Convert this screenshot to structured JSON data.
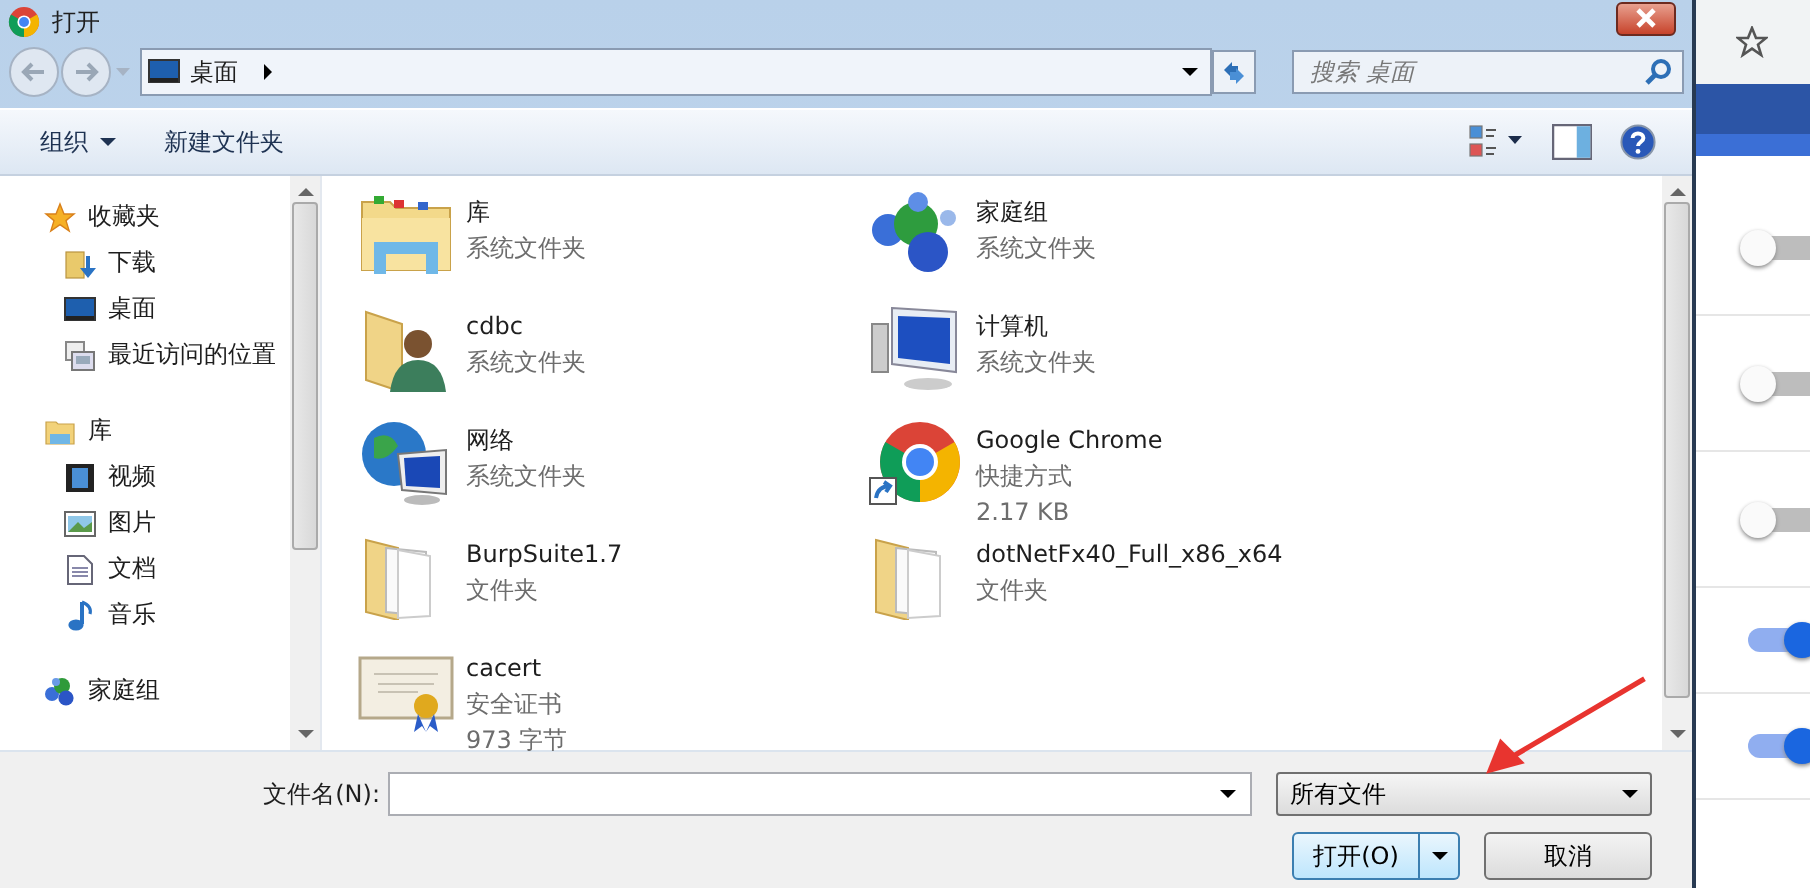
{
  "window": {
    "title": "打开"
  },
  "address": {
    "location": "桌面",
    "search_placeholder": "搜索 桌面"
  },
  "toolbar": {
    "organize": "组织",
    "new_folder": "新建文件夹"
  },
  "sidebar": {
    "groups": [
      {
        "label": "收藏夹",
        "kind": "star",
        "children": [
          {
            "label": "下载",
            "kind": "download"
          },
          {
            "label": "桌面",
            "kind": "desktop"
          },
          {
            "label": "最近访问的位置",
            "kind": "recent"
          }
        ]
      },
      {
        "label": "库",
        "kind": "library",
        "children": [
          {
            "label": "视频",
            "kind": "video"
          },
          {
            "label": "图片",
            "kind": "picture"
          },
          {
            "label": "文档",
            "kind": "document"
          },
          {
            "label": "音乐",
            "kind": "music"
          }
        ]
      },
      {
        "label": "家庭组",
        "kind": "homegroup"
      }
    ]
  },
  "files": [
    {
      "name": "库",
      "details": [
        "系统文件夹"
      ],
      "kind": "library"
    },
    {
      "name": "家庭组",
      "details": [
        "系统文件夹"
      ],
      "kind": "homegroup"
    },
    {
      "name": "cdbc",
      "details": [
        "系统文件夹"
      ],
      "kind": "user"
    },
    {
      "name": "计算机",
      "details": [
        "系统文件夹"
      ],
      "kind": "computer"
    },
    {
      "name": "网络",
      "details": [
        "系统文件夹"
      ],
      "kind": "network"
    },
    {
      "name": "Google Chrome",
      "details": [
        "快捷方式",
        "2.17 KB"
      ],
      "kind": "shortcut"
    },
    {
      "name": "BurpSuite1.7",
      "details": [
        "文件夹"
      ],
      "kind": "folder"
    },
    {
      "name": "dotNetFx40_Full_x86_x64",
      "details": [
        "文件夹"
      ],
      "kind": "folder"
    },
    {
      "name": "cacert",
      "details": [
        "安全证书",
        "973 字节"
      ],
      "kind": "certificate"
    }
  ],
  "footer": {
    "filename_label": "文件名(N):",
    "filter": "所有文件",
    "open": "打开(O)",
    "cancel": "取消"
  },
  "background_toggles": [
    {
      "on": false
    },
    {
      "on": false
    },
    {
      "on": false
    },
    {
      "on": true
    },
    {
      "on": true
    }
  ]
}
